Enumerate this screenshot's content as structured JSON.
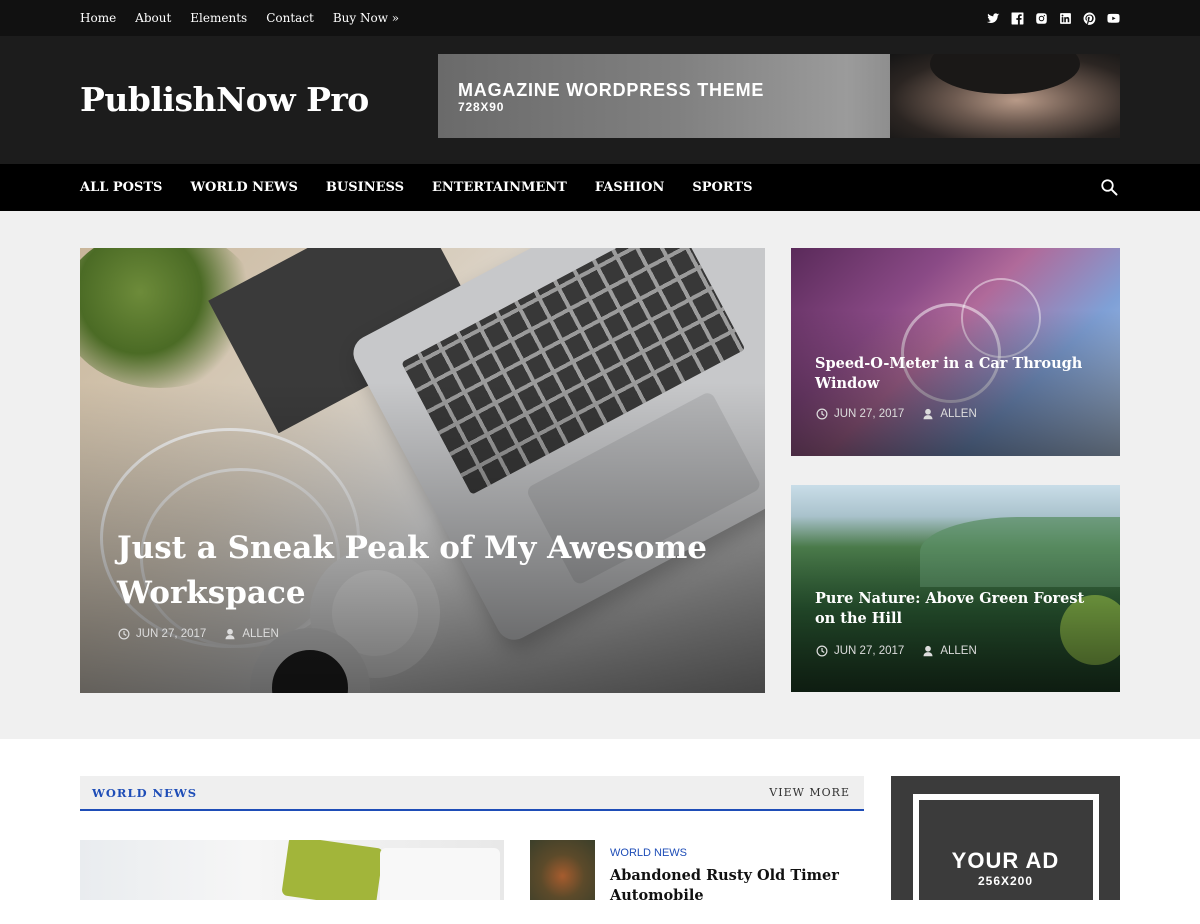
{
  "topbar": {
    "links": [
      "Home",
      "About",
      "Elements",
      "Contact",
      "Buy Now »"
    ],
    "social_icons": [
      "twitter-icon",
      "facebook-icon",
      "instagram-icon",
      "linkedin-icon",
      "pinterest-icon",
      "youtube-icon"
    ]
  },
  "header": {
    "site_title": "PublishNow Pro",
    "banner": {
      "line1": "MAGAZINE WORDPRESS THEME",
      "line2": "728X90"
    }
  },
  "mainnav": {
    "items": [
      "ALL POSTS",
      "WORLD NEWS",
      "BUSINESS",
      "ENTERTAINMENT",
      "FASHION",
      "SPORTS"
    ],
    "search_icon": "search-icon"
  },
  "featured": {
    "main": {
      "title": "Just a Sneak Peak of My Awesome Workspace",
      "date": "JUN 27, 2017",
      "author": "ALLEN"
    },
    "side": [
      {
        "title": "Speed-O-Meter in a Car Through Window",
        "date": "JUN 27, 2017",
        "author": "ALLEN"
      },
      {
        "title": "Pure Nature: Above Green Forest on the Hill",
        "date": "JUN 27, 2017",
        "author": "ALLEN"
      }
    ]
  },
  "world_news": {
    "title": "WORLD NEWS",
    "view_more": "VIEW MORE",
    "posts": [
      {
        "category": "WORLD NEWS",
        "title": "Abandoned Rusty Old Timer Automobile"
      }
    ]
  },
  "sidebar_ad": {
    "line1": "YOUR AD",
    "line2": "256X200"
  },
  "colors": {
    "accent": "#1e4db7",
    "topbar_bg": "#111111",
    "header_bg": "#1c1c1c",
    "nav_bg": "#000000"
  }
}
